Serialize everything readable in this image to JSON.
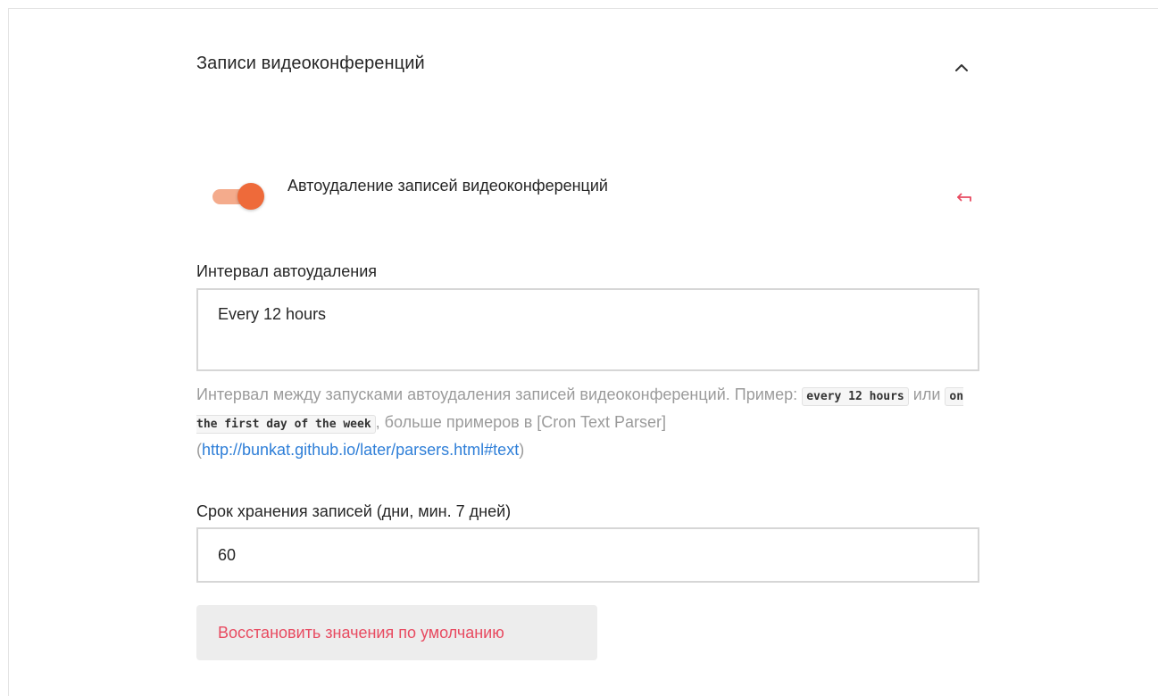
{
  "section": {
    "title": "Записи видеоконференций",
    "collapse_icon": "chevron-up-icon"
  },
  "auto_delete": {
    "toggle_label": "Автоудаление записей видеоконференций",
    "enabled": true,
    "reset_icon": "undo-arrow-icon",
    "colors": {
      "accent": "#ee6a3a",
      "track": "#f4ab8c",
      "reset": "#e84a60"
    }
  },
  "interval": {
    "label": "Интервал автоудаления",
    "value": "Every 12 hours",
    "hint": {
      "text_1": "Интервал между запусками автоудаления записей видеоконференций. Пример: ",
      "code_1": "every 12 hours",
      "text_2": " или ",
      "code_2": "on the first day of the week",
      "text_3": ", больше примеров в [Cron Text Parser] (",
      "link": "http://bunkat.github.io/later/parsers.html#text",
      "text_4": ")"
    }
  },
  "retention": {
    "label": "Срок хранения записей (дни, мин. 7 дней)",
    "value": "60"
  },
  "restore_button": {
    "label": "Восстановить значения по умолчанию"
  }
}
